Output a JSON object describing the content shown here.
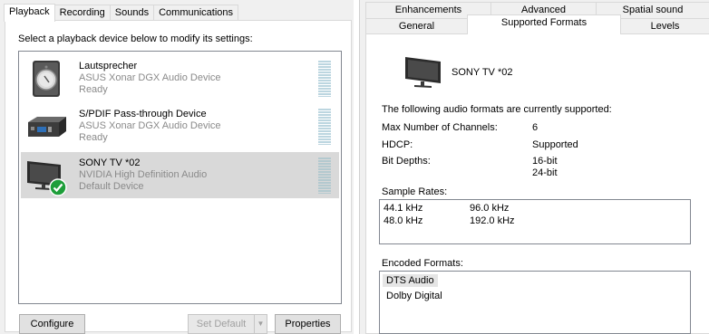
{
  "left": {
    "tabs": [
      "Playback",
      "Recording",
      "Sounds",
      "Communications"
    ],
    "instruction": "Select a playback device below to modify its settings:",
    "devices": [
      {
        "name": "Lautsprecher",
        "description": "ASUS Xonar DGX Audio Device",
        "status": "Ready",
        "icon": "speaker-icon"
      },
      {
        "name": "S/PDIF Pass-through Device",
        "description": "ASUS Xonar DGX Audio Device",
        "status": "Ready",
        "icon": "spdif-device-icon"
      },
      {
        "name": "SONY TV  *02",
        "description": "NVIDIA High Definition Audio",
        "status": "Default Device",
        "icon": "tv-monitor-icon",
        "selected": true
      }
    ],
    "buttons": {
      "configure": "Configure",
      "set_default": "Set Default",
      "properties": "Properties"
    }
  },
  "right": {
    "tabs_row1": [
      "Enhancements",
      "Advanced",
      "Spatial sound"
    ],
    "tabs_row2": [
      "General",
      "Supported Formats",
      "Levels"
    ],
    "active_tab": "Supported Formats",
    "device_name": "SONY TV  *02",
    "intro": "The following audio formats are currently supported:",
    "props": {
      "channels_label": "Max Number of Channels:",
      "channels_value": "6",
      "hdcp_label": "HDCP:",
      "hdcp_value": "Supported",
      "bitdepth_label": "Bit Depths:",
      "bitdepth_1": "16-bit",
      "bitdepth_2": "24-bit"
    },
    "sample_rates_label": "Sample Rates:",
    "sample_rates": [
      "44.1 kHz",
      "96.0 kHz",
      "48.0 kHz",
      "192.0 kHz"
    ],
    "encoded_label": "Encoded Formats:",
    "encoded_formats": [
      "DTS Audio",
      "Dolby Digital"
    ]
  },
  "colors": {
    "selected_row": "#d9d9d9",
    "default_badge": "#1e9e3a",
    "meter": "#bcd6e0"
  }
}
